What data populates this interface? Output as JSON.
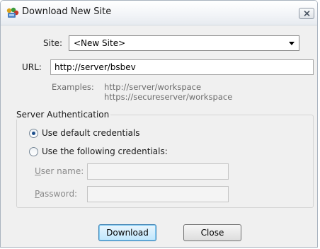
{
  "window": {
    "title": "Download New Site"
  },
  "site": {
    "label": "Site:",
    "selected": "<New Site>"
  },
  "url": {
    "label": "URL:",
    "value": "http://server/bsbev"
  },
  "examples": {
    "label": "Examples:",
    "line1": "http://server/workspace",
    "line2": "https://secureserver/workspace"
  },
  "auth": {
    "group_title": "Server Authentication",
    "option_default": "Use default credentials",
    "option_following": "Use the following credentials:",
    "selected": "default",
    "username_label_first": "U",
    "username_label_rest": "ser name:",
    "password_label_first": "P",
    "password_label_rest": "assword:",
    "username_value": "",
    "password_value": ""
  },
  "buttons": {
    "download_first": "D",
    "download_rest": "ownload",
    "close_first": "C",
    "close_rest": "lose"
  },
  "icons": {
    "app": "app-logo-icon",
    "close": "close-icon",
    "dropdown": "chevron-down-icon"
  }
}
